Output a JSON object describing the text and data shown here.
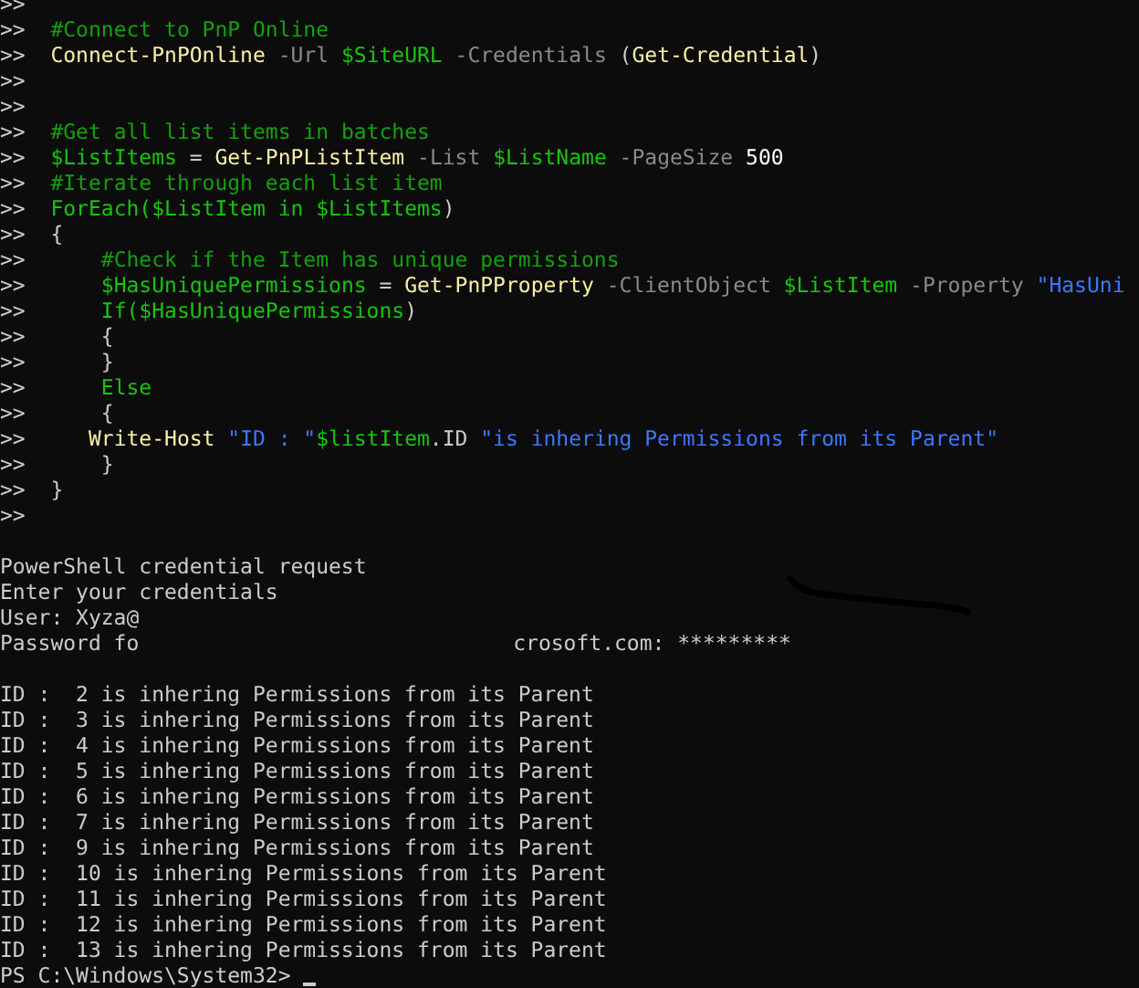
{
  "console": {
    "lines": [
      {
        "kind": "text",
        "tokens": [
          {
            "kind": "prompt",
            "text": ">>"
          }
        ]
      },
      {
        "kind": "text",
        "tokens": [
          {
            "kind": "prompt",
            "text": ">>"
          },
          {
            "kind": "comment",
            "text": "  #Connect to PnP Online"
          }
        ]
      },
      {
        "kind": "text",
        "tokens": [
          {
            "kind": "prompt",
            "text": ">>"
          },
          {
            "kind": "command",
            "text": "  Connect-PnPOnline"
          },
          {
            "kind": "param",
            "text": " -Url "
          },
          {
            "kind": "variable",
            "text": "$SiteURL"
          },
          {
            "kind": "param",
            "text": " -Credentials "
          },
          {
            "kind": "plain",
            "text": "("
          },
          {
            "kind": "command",
            "text": "Get-Credential"
          },
          {
            "kind": "plain",
            "text": ")"
          }
        ]
      },
      {
        "kind": "text",
        "tokens": [
          {
            "kind": "prompt",
            "text": ">>"
          }
        ]
      },
      {
        "kind": "text",
        "tokens": [
          {
            "kind": "prompt",
            "text": ">>"
          }
        ]
      },
      {
        "kind": "text",
        "tokens": [
          {
            "kind": "prompt",
            "text": ">>"
          },
          {
            "kind": "comment",
            "text": "  #Get all list items in batches"
          }
        ]
      },
      {
        "kind": "text",
        "tokens": [
          {
            "kind": "prompt",
            "text": ">>"
          },
          {
            "kind": "variable",
            "text": "  $ListItems"
          },
          {
            "kind": "plain",
            "text": " = "
          },
          {
            "kind": "command",
            "text": "Get-PnPListItem"
          },
          {
            "kind": "param",
            "text": " -List "
          },
          {
            "kind": "variable",
            "text": "$ListName"
          },
          {
            "kind": "param",
            "text": " -PageSize "
          },
          {
            "kind": "number",
            "text": "500"
          }
        ]
      },
      {
        "kind": "text",
        "tokens": [
          {
            "kind": "prompt",
            "text": ">>"
          },
          {
            "kind": "comment",
            "text": "  #Iterate through each list item"
          }
        ]
      },
      {
        "kind": "text",
        "tokens": [
          {
            "kind": "prompt",
            "text": ">>"
          },
          {
            "kind": "variable",
            "text": "  ForEach($ListItem in $ListItems"
          },
          {
            "kind": "plain",
            "text": ")"
          }
        ]
      },
      {
        "kind": "text",
        "tokens": [
          {
            "kind": "prompt",
            "text": ">>"
          },
          {
            "kind": "plain",
            "text": "  {"
          }
        ]
      },
      {
        "kind": "text",
        "tokens": [
          {
            "kind": "prompt",
            "text": ">>"
          },
          {
            "kind": "comment",
            "text": "      #Check if the Item has unique permissions"
          }
        ]
      },
      {
        "kind": "text",
        "tokens": [
          {
            "kind": "prompt",
            "text": ">>"
          },
          {
            "kind": "variable",
            "text": "      $HasUniquePermissions"
          },
          {
            "kind": "plain",
            "text": " = "
          },
          {
            "kind": "command",
            "text": "Get-PnPProperty"
          },
          {
            "kind": "param",
            "text": " -ClientObject "
          },
          {
            "kind": "variable",
            "text": "$ListItem"
          },
          {
            "kind": "param",
            "text": " -Property "
          },
          {
            "kind": "string",
            "text": "\"HasUni"
          }
        ]
      },
      {
        "kind": "text",
        "tokens": [
          {
            "kind": "prompt",
            "text": ">>"
          },
          {
            "kind": "variable",
            "text": "      If($HasUniquePermissions"
          },
          {
            "kind": "plain",
            "text": ")"
          }
        ]
      },
      {
        "kind": "text",
        "tokens": [
          {
            "kind": "prompt",
            "text": ">>"
          },
          {
            "kind": "plain",
            "text": "      {"
          }
        ]
      },
      {
        "kind": "text",
        "tokens": [
          {
            "kind": "prompt",
            "text": ">>"
          },
          {
            "kind": "plain",
            "text": "      }"
          }
        ]
      },
      {
        "kind": "text",
        "tokens": [
          {
            "kind": "prompt",
            "text": ">>"
          },
          {
            "kind": "variable",
            "text": "      Else"
          }
        ]
      },
      {
        "kind": "text",
        "tokens": [
          {
            "kind": "prompt",
            "text": ">>"
          },
          {
            "kind": "plain",
            "text": "      {"
          }
        ]
      },
      {
        "kind": "text",
        "tokens": [
          {
            "kind": "prompt",
            "text": ">>"
          },
          {
            "kind": "command",
            "text": "     Write-Host"
          },
          {
            "kind": "string",
            "text": " \"ID : \""
          },
          {
            "kind": "variable",
            "text": "$listItem"
          },
          {
            "kind": "plain",
            "text": ".ID"
          },
          {
            "kind": "string",
            "text": " \"is inhering Permissions from its Parent\""
          }
        ]
      },
      {
        "kind": "text",
        "tokens": [
          {
            "kind": "prompt",
            "text": ">>"
          },
          {
            "kind": "plain",
            "text": "      }"
          }
        ]
      },
      {
        "kind": "text",
        "tokens": [
          {
            "kind": "prompt",
            "text": ">>"
          },
          {
            "kind": "plain",
            "text": "  }"
          }
        ]
      },
      {
        "kind": "text",
        "tokens": [
          {
            "kind": "prompt",
            "text": ">>"
          }
        ]
      },
      {
        "kind": "blank"
      },
      {
        "kind": "text",
        "tokens": [
          {
            "kind": "output",
            "text": "PowerShell credential request"
          }
        ]
      },
      {
        "kind": "text",
        "tokens": [
          {
            "kind": "output",
            "text": "Enter your credentials"
          }
        ]
      },
      {
        "kind": "text",
        "tokens": [
          {
            "kind": "output",
            "text": "User: Xyza@"
          }
        ]
      },
      {
        "kind": "text",
        "redacted": true,
        "tokens": [
          {
            "kind": "output",
            "text": "Password fo"
          },
          {
            "kind": "output",
            "text": "crosoft.com: *********"
          }
        ]
      },
      {
        "kind": "blank"
      },
      {
        "kind": "text",
        "tokens": [
          {
            "kind": "output",
            "text": "ID :  2 is inhering Permissions from its Parent"
          }
        ]
      },
      {
        "kind": "text",
        "tokens": [
          {
            "kind": "output",
            "text": "ID :  3 is inhering Permissions from its Parent"
          }
        ]
      },
      {
        "kind": "text",
        "tokens": [
          {
            "kind": "output",
            "text": "ID :  4 is inhering Permissions from its Parent"
          }
        ]
      },
      {
        "kind": "text",
        "tokens": [
          {
            "kind": "output",
            "text": "ID :  5 is inhering Permissions from its Parent"
          }
        ]
      },
      {
        "kind": "text",
        "tokens": [
          {
            "kind": "output",
            "text": "ID :  6 is inhering Permissions from its Parent"
          }
        ]
      },
      {
        "kind": "text",
        "tokens": [
          {
            "kind": "output",
            "text": "ID :  7 is inhering Permissions from its Parent"
          }
        ]
      },
      {
        "kind": "text",
        "tokens": [
          {
            "kind": "output",
            "text": "ID :  9 is inhering Permissions from its Parent"
          }
        ]
      },
      {
        "kind": "text",
        "tokens": [
          {
            "kind": "output",
            "text": "ID :  10 is inhering Permissions from its Parent"
          }
        ]
      },
      {
        "kind": "text",
        "tokens": [
          {
            "kind": "output",
            "text": "ID :  11 is inhering Permissions from its Parent"
          }
        ]
      },
      {
        "kind": "text",
        "tokens": [
          {
            "kind": "output",
            "text": "ID :  12 is inhering Permissions from its Parent"
          }
        ]
      },
      {
        "kind": "text",
        "tokens": [
          {
            "kind": "output",
            "text": "ID :  13 is inhering Permissions from its Parent"
          }
        ]
      },
      {
        "kind": "text",
        "cursor": true,
        "tokens": [
          {
            "kind": "output",
            "text": "PS C:\\Windows\\System32> "
          }
        ]
      }
    ]
  }
}
